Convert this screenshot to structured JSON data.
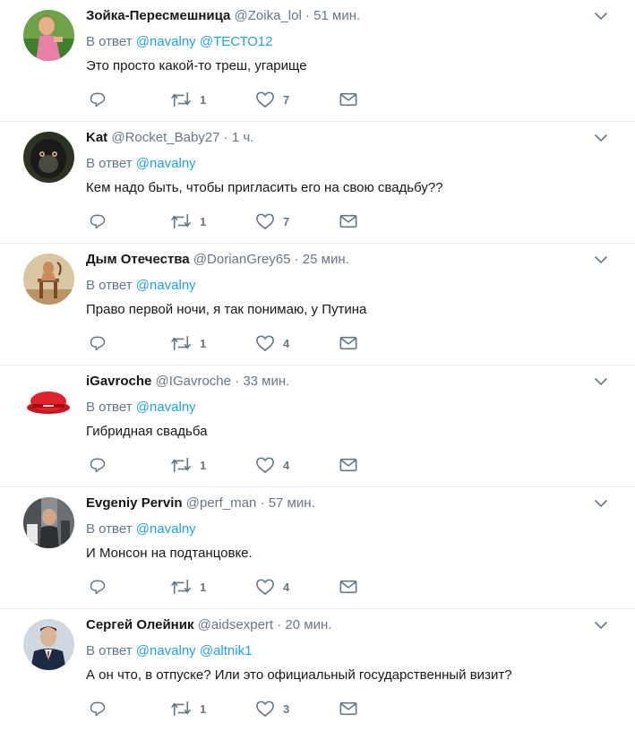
{
  "labels": {
    "reply_prefix": "В ответ"
  },
  "tweets": [
    {
      "name": "Зойка-Пересмешница",
      "handle": "@Zoika_lol",
      "time": "51 мин.",
      "mentions": [
        "@navalny",
        "@ТЕСТО12"
      ],
      "text": "Это просто какой-то треш, угарище",
      "retweets": "1",
      "likes": "7"
    },
    {
      "name": "Kat",
      "handle": "@Rocket_Baby27",
      "time": "1 ч.",
      "mentions": [
        "@navalny"
      ],
      "text": "Кем надо быть, чтобы пригласить его на свою свадьбу??",
      "retweets": "1",
      "likes": "7"
    },
    {
      "name": "Дым Отечества",
      "handle": "@DorianGrey65",
      "time": "25 мин.",
      "mentions": [
        "@navalny"
      ],
      "text": "Право первой ночи, я так понимаю, у Путина",
      "retweets": "1",
      "likes": "4"
    },
    {
      "name": "iGavroche",
      "handle": "@IGavroche",
      "time": "33 мин.",
      "mentions": [
        "@navalny"
      ],
      "text": "Гибридная свадьба",
      "retweets": "1",
      "likes": "4"
    },
    {
      "name": "Evgeniy Pervin",
      "handle": "@perf_man",
      "time": "57 мин.",
      "mentions": [
        "@navalny"
      ],
      "text": "И Монсон на подтанцовке.",
      "retweets": "1",
      "likes": "4"
    },
    {
      "name": "Сергей Олейник",
      "handle": "@aidsexpert",
      "time": "20 мин.",
      "mentions": [
        "@navalny",
        "@altnik1"
      ],
      "text": "А он что, в отпуске? Или это официальный государственный визит?",
      "retweets": "1",
      "likes": "3"
    }
  ],
  "colors": {
    "accent": "#1da1f2",
    "muted": "#657786",
    "text": "#14171a",
    "divider": "#e6ecf0"
  },
  "icons": {
    "reply": "reply-icon",
    "retweet": "retweet-icon",
    "like": "heart-icon",
    "message": "envelope-icon",
    "menu": "chevron-down-icon"
  }
}
